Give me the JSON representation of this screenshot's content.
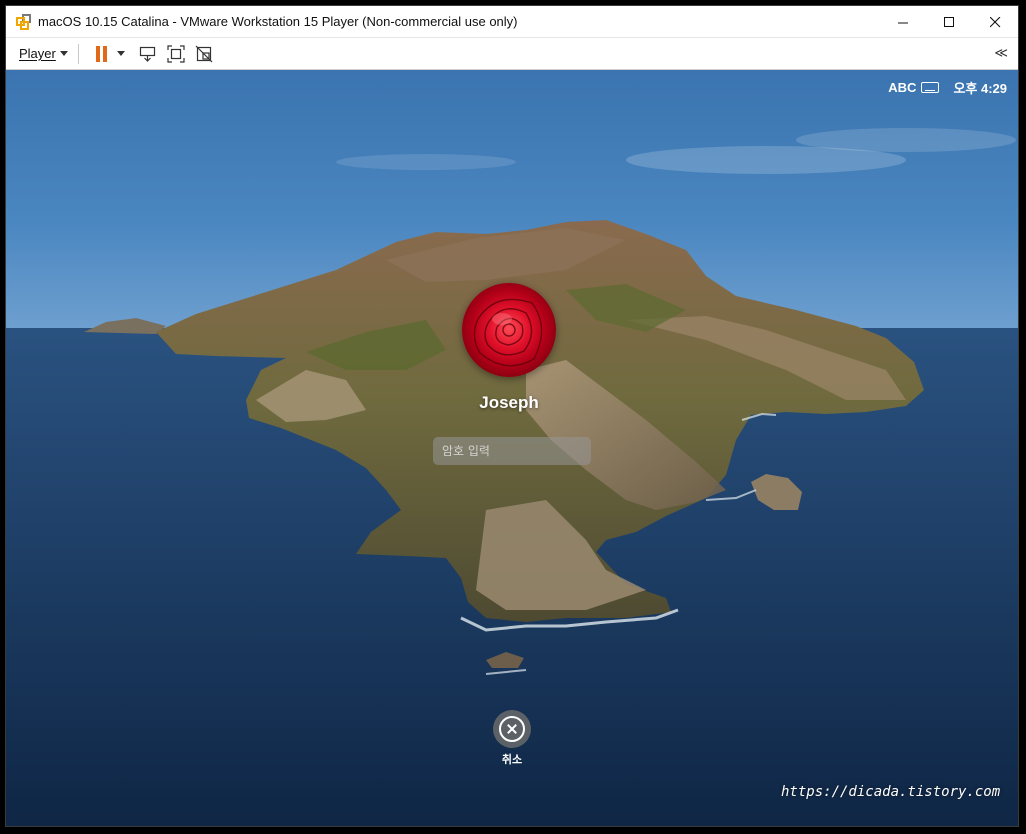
{
  "window": {
    "title": "macOS 10.15 Catalina - VMware Workstation 15 Player (Non-commercial use only)",
    "controls": {
      "minimize": "─",
      "maximize": "☐",
      "close": "✕"
    }
  },
  "toolbar": {
    "player_label": "Player",
    "icons": [
      "pause-icon",
      "send-ctrl-alt-del-icon",
      "fullscreen-icon",
      "unity-icon"
    ],
    "collapse_label": "≪",
    "accent": "#e06a1a"
  },
  "guest": {
    "menubar": {
      "input_source": "ABC",
      "clock": "오후 4:29"
    },
    "login": {
      "user_name": "Joseph",
      "password_placeholder": "암호 입력",
      "password_value": "",
      "cancel_label": "취소"
    },
    "watermark": "https://dicada.tistory.com"
  }
}
